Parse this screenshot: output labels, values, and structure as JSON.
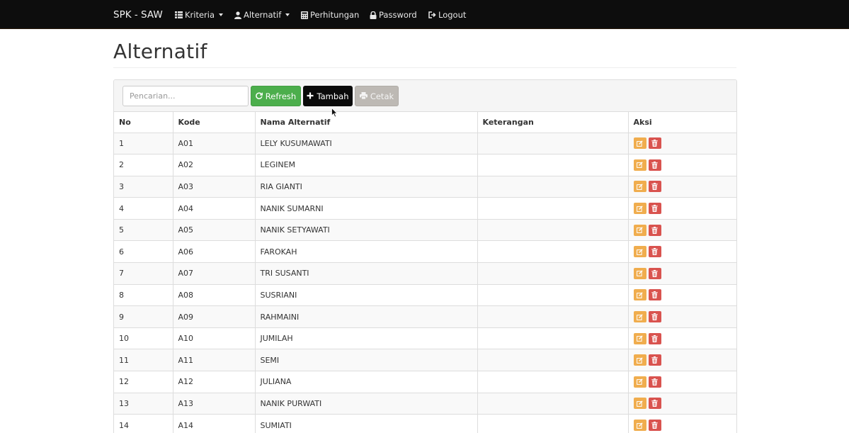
{
  "navbar": {
    "brand": "SPK - SAW",
    "items": [
      {
        "label": "Kriteria",
        "icon": "grid-icon",
        "dropdown": true
      },
      {
        "label": "Alternatif",
        "icon": "user-icon",
        "dropdown": true
      },
      {
        "label": "Perhitungan",
        "icon": "calculator-icon",
        "dropdown": false
      },
      {
        "label": "Password",
        "icon": "lock-icon",
        "dropdown": false
      },
      {
        "label": "Logout",
        "icon": "logout-icon",
        "dropdown": false
      }
    ]
  },
  "page": {
    "title": "Alternatif"
  },
  "toolbar": {
    "search_placeholder": "Pencarian...",
    "refresh_label": "Refresh",
    "tambah_label": "Tambah",
    "cetak_label": "Cetak"
  },
  "table": {
    "headers": [
      "No",
      "Kode",
      "Nama Alternatif",
      "Keterangan",
      "Aksi"
    ],
    "rows": [
      {
        "no": "1",
        "kode": "A01",
        "nama": "LELY KUSUMAWATI",
        "keterangan": ""
      },
      {
        "no": "2",
        "kode": "A02",
        "nama": "LEGINEM",
        "keterangan": ""
      },
      {
        "no": "3",
        "kode": "A03",
        "nama": "RIA GIANTI",
        "keterangan": ""
      },
      {
        "no": "4",
        "kode": "A04",
        "nama": "NANIK SUMARNI",
        "keterangan": ""
      },
      {
        "no": "5",
        "kode": "A05",
        "nama": "NANIK SETYAWATI",
        "keterangan": ""
      },
      {
        "no": "6",
        "kode": "A06",
        "nama": "FAROKAH",
        "keterangan": ""
      },
      {
        "no": "7",
        "kode": "A07",
        "nama": "TRI SUSANTI",
        "keterangan": ""
      },
      {
        "no": "8",
        "kode": "A08",
        "nama": "SUSRIANI",
        "keterangan": ""
      },
      {
        "no": "9",
        "kode": "A09",
        "nama": "RAHMAINI",
        "keterangan": ""
      },
      {
        "no": "10",
        "kode": "A10",
        "nama": "JUMILAH",
        "keterangan": ""
      },
      {
        "no": "11",
        "kode": "A11",
        "nama": "SEMI",
        "keterangan": ""
      },
      {
        "no": "12",
        "kode": "A12",
        "nama": "JULIANA",
        "keterangan": ""
      },
      {
        "no": "13",
        "kode": "A13",
        "nama": "NANIK PURWATI",
        "keterangan": ""
      },
      {
        "no": "14",
        "kode": "A14",
        "nama": "SUMIATI",
        "keterangan": ""
      }
    ]
  },
  "colors": {
    "navbar_bg": "#0d0d0d",
    "refresh_btn": "#4cae4c",
    "tambah_btn": "#0a0a0a",
    "cetak_btn": "#bdb9b4",
    "edit_btn": "#f0ad4e",
    "delete_btn": "#d9534f"
  }
}
